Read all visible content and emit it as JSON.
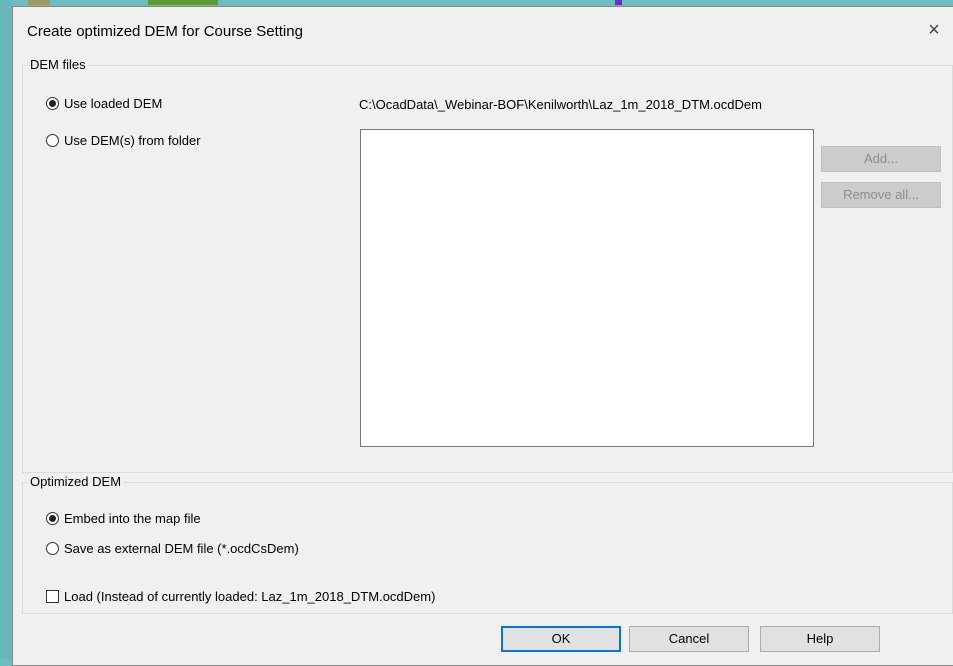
{
  "window": {
    "title": "Create optimized DEM for Course Setting",
    "close_glyph": "×"
  },
  "dem_files": {
    "group_title": "DEM files",
    "use_loaded_label": "Use loaded DEM",
    "use_loaded_selected": true,
    "loaded_path": "C:\\OcadData\\_Webinar-BOF\\Kenilworth\\Laz_1m_2018_DTM.ocdDem",
    "use_folder_label": "Use DEM(s) from folder",
    "use_folder_selected": false,
    "folder_items": [],
    "add_label": "Add...",
    "remove_all_label": "Remove all..."
  },
  "optimized_dem": {
    "group_title": "Optimized DEM",
    "embed_label": "Embed into the map file",
    "embed_selected": true,
    "save_external_label": "Save as external DEM file (*.ocdCsDem)",
    "save_external_selected": false,
    "load_label": "Load (Instead of currently loaded: Laz_1m_2018_DTM.ocdDem)",
    "load_checked": false
  },
  "footer": {
    "ok_label": "OK",
    "cancel_label": "Cancel",
    "help_label": "Help"
  },
  "colors": {
    "background": "#6fbcbf",
    "dialog": "#f0f0f0",
    "default_button_border": "#0078d7"
  }
}
